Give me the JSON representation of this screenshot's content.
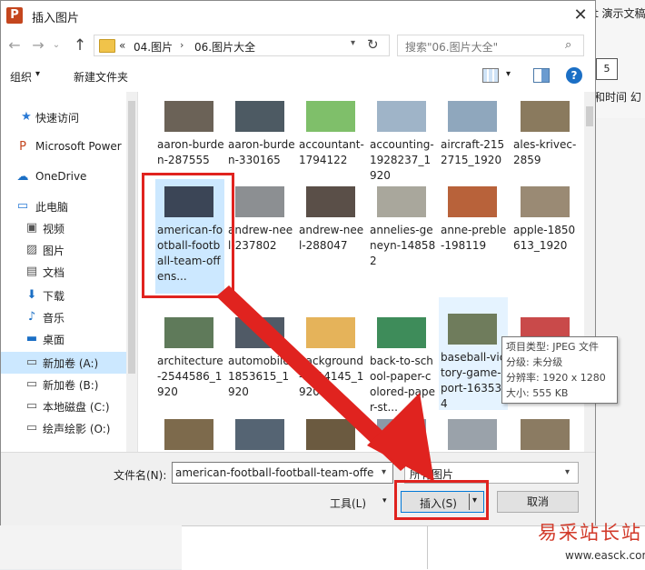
{
  "background_app": {
    "ribbon_title_fragment": "t 演示文稿",
    "ribbon_label": "和时间 幻",
    "ribbon_icon": "5"
  },
  "dialog": {
    "title": "插入图片",
    "app_icon_letter": "P",
    "close_icon": "✕"
  },
  "nav": {
    "back_icon": "←",
    "forward_icon": "→",
    "history_icon": "⌄",
    "up_icon": "↑",
    "breadcrumb_prefix": "«",
    "breadcrumb": [
      "04.图片",
      "06.图片大全"
    ],
    "separator_icon": "›",
    "refresh_icon": "↻",
    "search_placeholder": "搜索\"06.图片大全\"",
    "search_icon": "⌕"
  },
  "toolbar": {
    "organize": "组织",
    "new_folder": "新建文件夹",
    "caret": "▾",
    "help": "?"
  },
  "sidebar": {
    "items": [
      {
        "label": "快速访问",
        "icon": "★",
        "color": "#2a7ad5"
      },
      {
        "label": "Microsoft Power",
        "icon": "P",
        "color": "#c4461e"
      },
      {
        "label": "OneDrive",
        "icon": "☁",
        "color": "#1b6fc5"
      },
      {
        "label": "此电脑",
        "icon": "▭",
        "color": "#2a7ad5"
      },
      {
        "label": "视频",
        "icon": "▣",
        "color": "#555"
      },
      {
        "label": "图片",
        "icon": "▨",
        "color": "#555"
      },
      {
        "label": "文档",
        "icon": "▤",
        "color": "#555"
      },
      {
        "label": "下载",
        "icon": "⬇",
        "color": "#1b6fc5"
      },
      {
        "label": "音乐",
        "icon": "♪",
        "color": "#1b6fc5"
      },
      {
        "label": "桌面",
        "icon": "▬",
        "color": "#1b6fc5"
      },
      {
        "label": "新加卷 (A:)",
        "icon": "▭",
        "color": "#555"
      },
      {
        "label": "新加卷 (B:)",
        "icon": "▭",
        "color": "#555"
      },
      {
        "label": "本地磁盘 (C:)",
        "icon": "▭",
        "color": "#555"
      },
      {
        "label": "绘声绘影 (O:)",
        "icon": "▭",
        "color": "#555"
      }
    ]
  },
  "files": [
    {
      "label": "aaron-burden-287555",
      "color": "#6b6257"
    },
    {
      "label": "aaron-burden-330165",
      "color": "#4d5a63"
    },
    {
      "label": "accountant-1794122",
      "color": "#7fbf6a"
    },
    {
      "label": "accounting-1928237_1920",
      "color": "#9fb4c8"
    },
    {
      "label": "aircraft-2152715_1920",
      "color": "#8fa7bd"
    },
    {
      "label": "ales-krivec-2859",
      "color": "#8a7a5e"
    },
    {
      "label": "american-football-football-team-offens...",
      "color": "#3b4556"
    },
    {
      "label": "andrew-neel-237802",
      "color": "#8c8f92"
    },
    {
      "label": "andrew-neel-288047",
      "color": "#5a4f48"
    },
    {
      "label": "annelies-geneyn-148582",
      "color": "#a9a79c"
    },
    {
      "label": "anne-preble-198119",
      "color": "#b8623a"
    },
    {
      "label": "apple-1850613_1920",
      "color": "#9a8a74"
    },
    {
      "label": "architecture-2544586_1920",
      "color": "#5f7a5a"
    },
    {
      "label": "automobile-1853615_1920",
      "color": "#505a66"
    },
    {
      "label": "background-1614145_1920",
      "color": "#e5b35a"
    },
    {
      "label": "back-to-school-paper-colored-paper-st...",
      "color": "#3e8c5a"
    },
    {
      "label": "baseball-victory-game-sport-163534",
      "color": "#6f7c5c"
    },
    {
      "label": "",
      "color": "#c94a4a"
    },
    {
      "label": "",
      "color": "#7d6a4c"
    },
    {
      "label": "",
      "color": "#556473"
    },
    {
      "label": "",
      "color": "#6b5a40"
    },
    {
      "label": "",
      "color": "#8a9aa8"
    },
    {
      "label": "",
      "color": "#9aa2aa"
    },
    {
      "label": "",
      "color": "#8b7b62"
    }
  ],
  "tooltip": {
    "type": "项目类型: JPEG 文件",
    "rating": "分级: 未分级",
    "resolution": "分辨率: 1920 x 1280",
    "size": "大小: 555 KB"
  },
  "bottom": {
    "filename_label": "文件名(N):",
    "filename_value": "american-football-football-team-offe",
    "filetype": "所有图片",
    "tools": "工具(L)",
    "insert": "插入(S)",
    "cancel": "取消",
    "caret": "▾"
  },
  "watermark": {
    "main": "易采站长站",
    "url": "www.easck.com"
  }
}
